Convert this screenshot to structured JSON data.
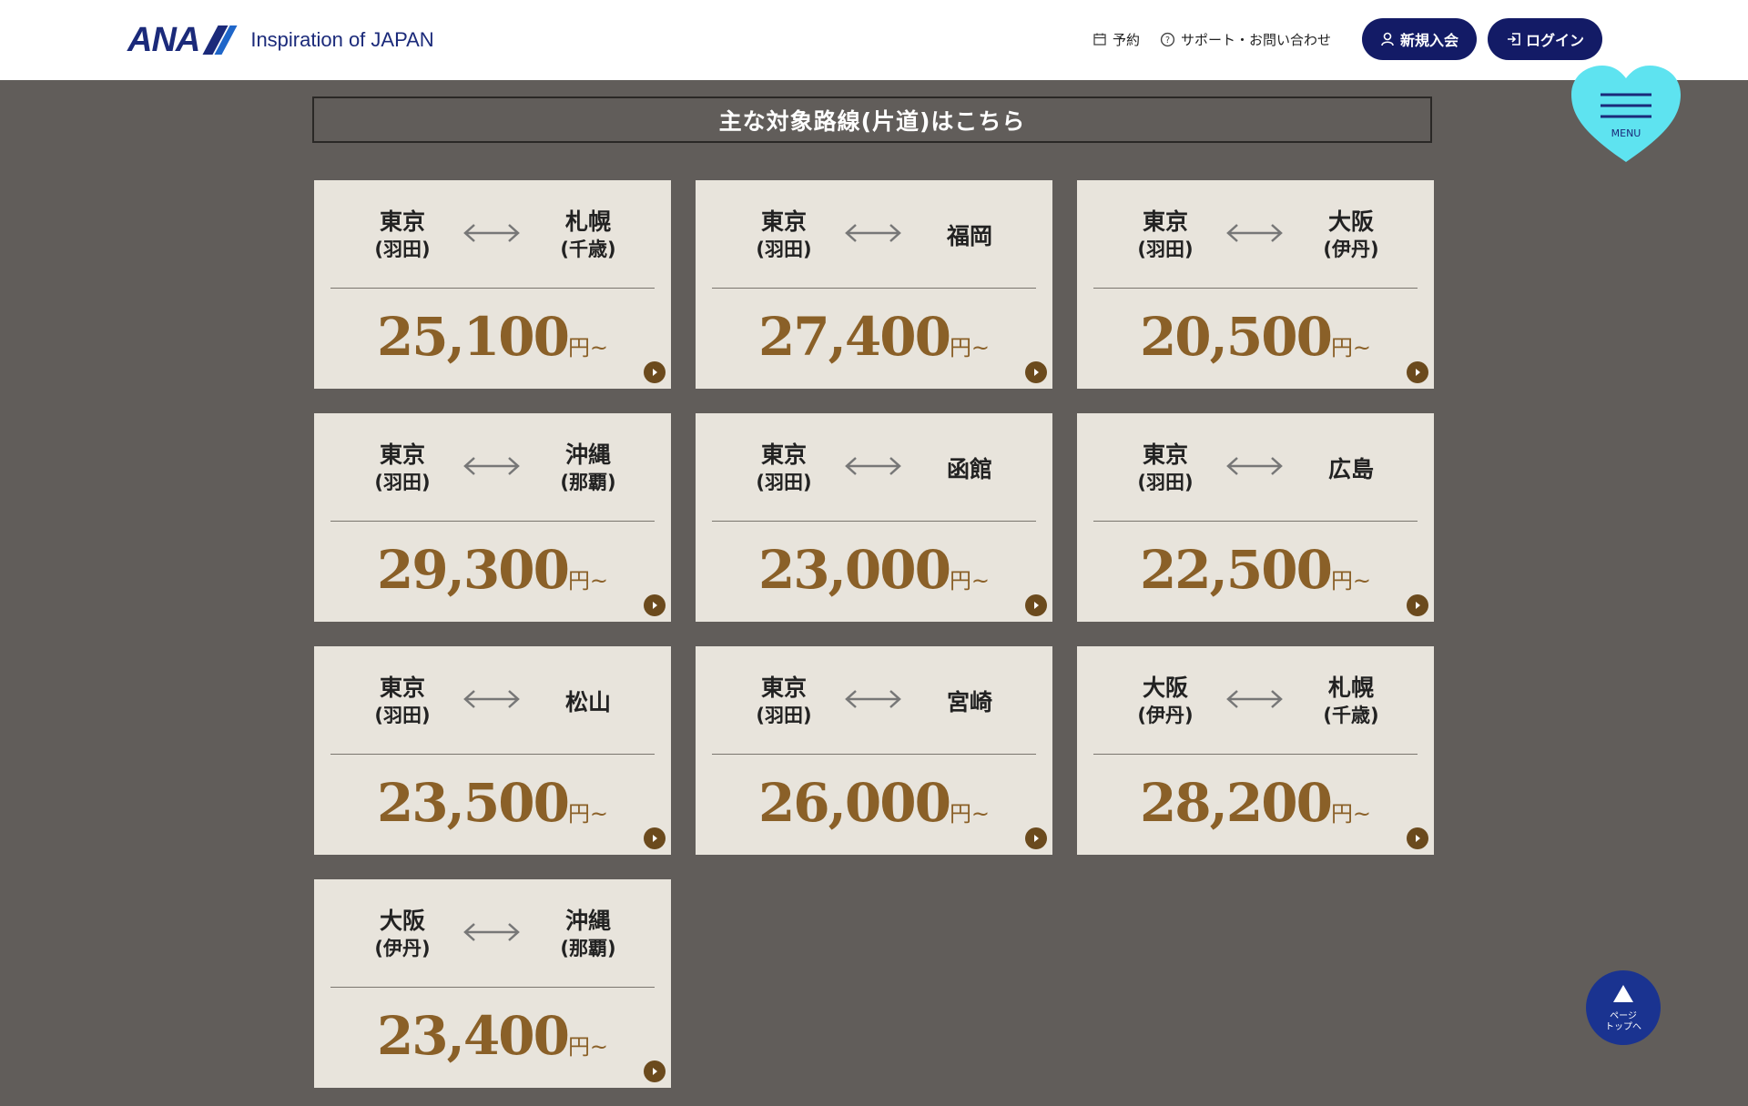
{
  "header": {
    "logo_mark": "ANA",
    "tagline": "Inspiration of JAPAN",
    "nav": {
      "reserve": "予約",
      "support": "サポート・お問い合わせ",
      "signup": "新規入会",
      "login": "ログイン"
    }
  },
  "section": {
    "title": "主な対象路線(片道)はこちら"
  },
  "routes": [
    {
      "from": "東京",
      "from_sub": "(羽田)",
      "to": "札幌",
      "to_sub": "(千歳)",
      "price": "25,100",
      "unit": "円~"
    },
    {
      "from": "東京",
      "from_sub": "(羽田)",
      "to": "福岡",
      "to_sub": "",
      "price": "27,400",
      "unit": "円~"
    },
    {
      "from": "東京",
      "from_sub": "(羽田)",
      "to": "大阪",
      "to_sub": "(伊丹)",
      "price": "20,500",
      "unit": "円~"
    },
    {
      "from": "東京",
      "from_sub": "(羽田)",
      "to": "沖縄",
      "to_sub": "(那覇)",
      "price": "29,300",
      "unit": "円~"
    },
    {
      "from": "東京",
      "from_sub": "(羽田)",
      "to": "函館",
      "to_sub": "",
      "price": "23,000",
      "unit": "円~"
    },
    {
      "from": "東京",
      "from_sub": "(羽田)",
      "to": "広島",
      "to_sub": "",
      "price": "22,500",
      "unit": "円~"
    },
    {
      "from": "東京",
      "from_sub": "(羽田)",
      "to": "松山",
      "to_sub": "",
      "price": "23,500",
      "unit": "円~"
    },
    {
      "from": "東京",
      "from_sub": "(羽田)",
      "to": "宮崎",
      "to_sub": "",
      "price": "26,000",
      "unit": "円~"
    },
    {
      "from": "大阪",
      "from_sub": "(伊丹)",
      "to": "札幌",
      "to_sub": "(千歳)",
      "price": "28,200",
      "unit": "円~"
    },
    {
      "from": "大阪",
      "from_sub": "(伊丹)",
      "to": "沖縄",
      "to_sub": "(那覇)",
      "price": "23,400",
      "unit": "円~"
    }
  ],
  "menu": {
    "label": "MENU",
    "color": "#5ee3f0"
  },
  "page_top": {
    "line1": "ページ",
    "line2": "トップへ"
  },
  "colors": {
    "background": "#615d5a",
    "card": "#e8e4dc",
    "price": "#8a6028",
    "navy": "#131b66"
  }
}
